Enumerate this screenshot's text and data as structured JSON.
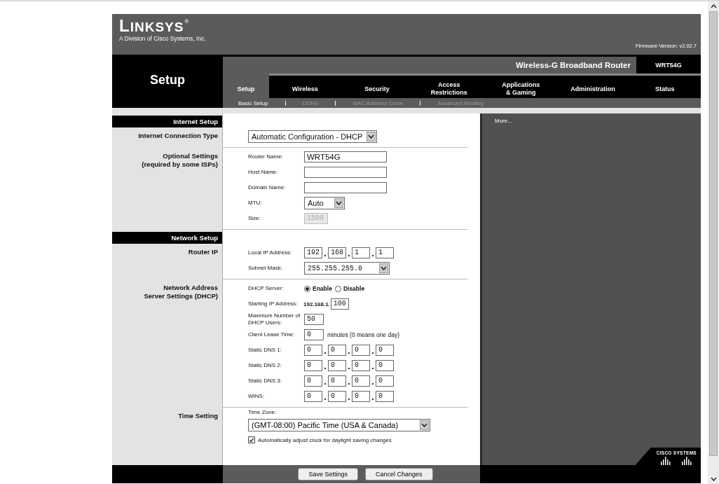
{
  "header": {
    "brand": "LINKSYS",
    "brand_mark": "®",
    "brand_sub": "A Division of Cisco Systems, Inc.",
    "firmware": "Firmware Version: v2.02.7",
    "product": "Wireless-G Broadband Router",
    "model": "WRT54G",
    "page_title": "Setup"
  },
  "tabs": [
    {
      "lines": [
        "Setup"
      ],
      "selected": true
    },
    {
      "lines": [
        "Wireless"
      ],
      "selected": false
    },
    {
      "lines": [
        "Security"
      ],
      "selected": false
    },
    {
      "lines": [
        "Access",
        "Restrictions"
      ],
      "selected": false
    },
    {
      "lines": [
        "Applications",
        "& Gaming"
      ],
      "selected": false
    },
    {
      "lines": [
        "Administration"
      ],
      "selected": false
    },
    {
      "lines": [
        "Status"
      ],
      "selected": false
    }
  ],
  "subtabs": [
    {
      "label": "Basic Setup",
      "selected": true
    },
    {
      "label": "DDNS",
      "selected": false
    },
    {
      "label": "MAC Address Clone",
      "selected": false
    },
    {
      "label": "Advanced Routing",
      "selected": false
    }
  ],
  "help_link": "More...",
  "sections": [
    {
      "title": "Internet Setup",
      "groups": [
        {
          "label_lines": [
            "Internet Connection Type"
          ],
          "fields": [
            {
              "kind": "select",
              "value": "Automatic Configuration - DHCP"
            }
          ]
        },
        {
          "label_lines": [
            "Optional Settings",
            "(required by some ISPs)"
          ],
          "fields": [
            {
              "kind": "text",
              "label": "Router Name:",
              "value": "WRT54G"
            },
            {
              "kind": "text",
              "label": "Host Name:"
            },
            {
              "kind": "text",
              "label": "Domain Name:"
            },
            {
              "kind": "select",
              "label": "MTU:",
              "value": "Auto"
            },
            {
              "kind": "number",
              "label": "Size:",
              "value": "1500",
              "disabled": true
            }
          ]
        }
      ]
    },
    {
      "title": "Network Setup",
      "groups": [
        {
          "label_lines": [
            "Router IP"
          ],
          "fields": [
            {
              "kind": "ip",
              "label": "Local IP Address:",
              "octets": [
                "192",
                "168",
                "1",
                "1"
              ]
            },
            {
              "kind": "mask_select",
              "label": "Subnet Mask:",
              "value": "255.255.255.0"
            }
          ]
        },
        {
          "label_lines": [
            "Network Address",
            "Server Settings (DHCP)"
          ],
          "fields": [
            {
              "kind": "radio",
              "label": "DHCP Server:",
              "options": [
                {
                  "label": "Enable",
                  "selected": true
                },
                {
                  "label": "Disable",
                  "selected": false
                }
              ]
            },
            {
              "kind": "prefixed",
              "label": "Starting IP Address:",
              "prefix": "192.168.1.",
              "value": "100"
            },
            {
              "kind": "number",
              "label": "Maximum Number of DHCP Users:",
              "value": "50"
            },
            {
              "kind": "number",
              "label": "Client Lease Time:",
              "value": "0",
              "suffix": "minutes (0 means one day)"
            },
            {
              "kind": "ip",
              "label": "Static DNS 1:",
              "octets": [
                "0",
                "0",
                "0",
                "0"
              ]
            },
            {
              "kind": "ip",
              "label": "Static DNS 2:",
              "octets": [
                "0",
                "0",
                "0",
                "0"
              ]
            },
            {
              "kind": "ip",
              "label": "Static DNS 3:",
              "octets": [
                "0",
                "0",
                "0",
                "0"
              ]
            },
            {
              "kind": "ip",
              "label": "WINS:",
              "octets": [
                "0",
                "0",
                "0",
                "0"
              ]
            }
          ]
        },
        {
          "label_lines": [
            "Time Setting"
          ],
          "fields": [
            {
              "kind": "stacked_select",
              "label": "Time Zone:",
              "value": "(GMT-08:00) Pacific Time (USA & Canada)"
            },
            {
              "kind": "checkbox",
              "label": "Automatically adjust clock for daylight saving changes",
              "checked": true
            }
          ]
        }
      ]
    }
  ],
  "cisco_logo": "CISCO SYSTEMS",
  "buttons": [
    "Save Settings",
    "Cancel Changes"
  ]
}
